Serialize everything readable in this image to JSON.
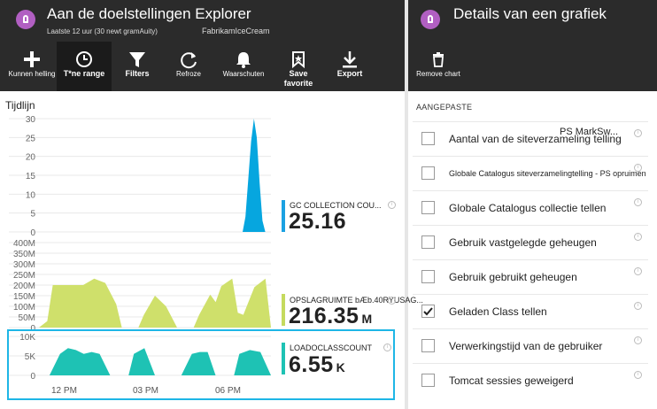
{
  "left_panel": {
    "title": "Aan de doelstellingen Explorer",
    "subtitle_time": "Laatste 12 uur (30 newt gramAuity)",
    "subtitle_app": "FabrikamIceCream",
    "toolbar": [
      {
        "id": "add",
        "label": "Kunnen helling",
        "icon": "plus-icon"
      },
      {
        "id": "time",
        "label": "T*ne range",
        "icon": "clock-icon"
      },
      {
        "id": "filters",
        "label": "Filters",
        "icon": "filter-icon"
      },
      {
        "id": "refresh",
        "label": "Refroze",
        "icon": "refresh-icon"
      },
      {
        "id": "alerts",
        "label": "Waarschuten",
        "icon": "bell-icon"
      },
      {
        "id": "save",
        "label": "Save favorite",
        "icon": "bookmark-icon"
      },
      {
        "id": "export",
        "label": "Export",
        "icon": "download-icon"
      }
    ],
    "timeline_label": "Tijdlijn",
    "legends": [
      {
        "name": "GC COLLECTION COU...",
        "value": "25.16",
        "unit": "",
        "color": "#1ba1e2"
      },
      {
        "name": "OPSLAGRUIMTE bÆb.40RYUSAG...",
        "value": "216.35",
        "unit": "M",
        "color": "#c5da5e"
      },
      {
        "name": "LOADOCLASSCOUNT",
        "value": "6.55",
        "unit": "K",
        "color": "#1ec2b4"
      }
    ]
  },
  "right_panel": {
    "title": "Details van een grafiek",
    "remove_label": "Remove chart",
    "section_label": "AANGEPASTE",
    "items": [
      {
        "label": "Aantal van de siteverzameling telling",
        "overlay": "PS MarkSw...",
        "checked": false,
        "small": false
      },
      {
        "label": "Globale Catalogus siteverzamelingtelling - PS opruimen",
        "checked": false,
        "small": true
      },
      {
        "label": "Globale Catalogus collectie tellen",
        "checked": false,
        "small": false
      },
      {
        "label": "Gebruik vastgelegde geheugen",
        "checked": false,
        "small": false
      },
      {
        "label": "Gebruik gebruikt geheugen",
        "checked": false,
        "small": false
      },
      {
        "label": "Geladen Class tellen",
        "checked": true,
        "small": false
      },
      {
        "label": "Verwerkingstijd van de gebruiker",
        "checked": false,
        "small": false
      },
      {
        "label": "Tomcat sessies geweigerd",
        "checked": false,
        "small": false
      }
    ]
  },
  "colors": {
    "header_bg": "#2b2b2b",
    "accent_purple": "#b15fc2",
    "selection_outline": "#1eb6e6"
  },
  "chart_data": [
    {
      "type": "area",
      "title": "",
      "series": [
        {
          "name": "GC COLLECTION COU...",
          "values": [
            0,
            0,
            0,
            0,
            0,
            0,
            0,
            0,
            0,
            0,
            0,
            0,
            0,
            0,
            0,
            0,
            0,
            0,
            0,
            0,
            0,
            0,
            0,
            0,
            0,
            0,
            0,
            0,
            0,
            0,
            0,
            0,
            0,
            0,
            0,
            0,
            0,
            0,
            0,
            0,
            0,
            0,
            0,
            0,
            0,
            0,
            0,
            0,
            0,
            0,
            0,
            0,
            0,
            0,
            0,
            0,
            0,
            0,
            0,
            0,
            0,
            0,
            0,
            0,
            0,
            0,
            0,
            0,
            0,
            0,
            0,
            0,
            0,
            4,
            14,
            24,
            30,
            25,
            13,
            3,
            0,
            0,
            0
          ]
        }
      ],
      "yticks": [
        "30",
        "25",
        "20",
        "15",
        "10",
        "5",
        "0"
      ],
      "ylim": [
        0,
        30
      ]
    },
    {
      "type": "area",
      "title": "",
      "series": [
        {
          "name": "OPSLAGRUIMTE bÆb.40RYUSAG...",
          "values": [
            0,
            0,
            0,
            0,
            0,
            0,
            0,
            0,
            0,
            0,
            0,
            0,
            0,
            0,
            0,
            0,
            0,
            0,
            0,
            0,
            0,
            0,
            0,
            0,
            0,
            0,
            0,
            0,
            0,
            0,
            0,
            0,
            0,
            0,
            0,
            0,
            0,
            0,
            0,
            0,
            0,
            0,
            0,
            0,
            0,
            0,
            0,
            0,
            0,
            0,
            0,
            0,
            0,
            0,
            0,
            0,
            0,
            0,
            0,
            0,
            0,
            0,
            0,
            0,
            0,
            0,
            0,
            0,
            0,
            0,
            0,
            0,
            0,
            0,
            0,
            0,
            0,
            0,
            0,
            0,
            0,
            0,
            0
          ]
        }
      ],
      "area_points": [
        [
          0,
          0
        ],
        [
          3,
          30
        ],
        [
          5,
          200
        ],
        [
          16,
          200
        ],
        [
          20,
          230
        ],
        [
          24,
          210
        ],
        [
          28,
          110
        ],
        [
          30,
          0
        ],
        [
          36,
          0
        ],
        [
          38,
          60
        ],
        [
          42,
          150
        ],
        [
          46,
          100
        ],
        [
          50,
          0
        ],
        [
          56,
          0
        ],
        [
          58,
          60
        ],
        [
          62,
          155
        ],
        [
          64,
          120
        ],
        [
          66,
          195
        ],
        [
          70,
          230
        ],
        [
          72,
          70
        ],
        [
          74,
          60
        ],
        [
          78,
          190
        ],
        [
          82,
          230
        ],
        [
          84,
          0
        ]
      ],
      "x_range": [
        0,
        84
      ],
      "yticks": [
        "400M",
        "350M",
        "300M",
        "250M",
        "200M",
        "150M",
        "100M",
        "50M",
        "0"
      ],
      "ylim": [
        0,
        400
      ]
    },
    {
      "type": "area",
      "title": "",
      "area_points": [
        [
          0,
          0
        ],
        [
          4,
          0
        ],
        [
          8,
          5.5
        ],
        [
          11,
          7
        ],
        [
          14,
          6.5
        ],
        [
          17,
          5.5
        ],
        [
          20,
          6
        ],
        [
          23,
          5.5
        ],
        [
          27,
          0
        ],
        [
          34,
          0
        ],
        [
          36,
          5.5
        ],
        [
          40,
          7
        ],
        [
          44,
          0
        ],
        [
          54,
          0
        ],
        [
          58,
          5.5
        ],
        [
          61,
          6
        ],
        [
          64,
          6
        ],
        [
          67,
          0
        ],
        [
          74,
          0
        ],
        [
          76,
          5.5
        ],
        [
          80,
          6.5
        ],
        [
          84,
          6
        ],
        [
          88,
          0
        ]
      ],
      "x_range": [
        0,
        88
      ],
      "yticks": [
        "10K",
        "5K",
        "0"
      ],
      "ylim": [
        0,
        10
      ],
      "xticks": [
        "12 PM",
        "03 PM",
        "06 PM"
      ]
    }
  ]
}
